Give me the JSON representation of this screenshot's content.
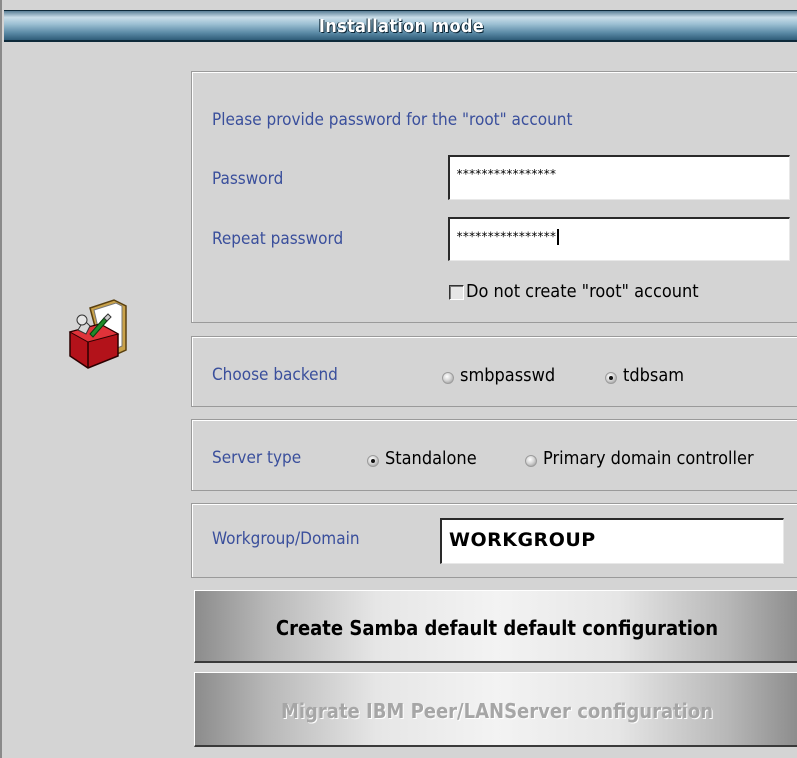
{
  "window": {
    "title": "Installation mode"
  },
  "icon": "samba-toolbox-icon",
  "password_panel": {
    "heading": "Please provide password for the \"root\" account",
    "password_label": "Password",
    "password_value": "****************",
    "repeat_label": "Repeat password",
    "repeat_value": "****************",
    "no_root_label": "Do not create \"root\" account",
    "no_root_checked": false
  },
  "backend_panel": {
    "label": "Choose backend",
    "options": [
      {
        "label": "smbpasswd",
        "checked": false
      },
      {
        "label": "tdbsam",
        "checked": true
      }
    ]
  },
  "server_panel": {
    "label": "Server type",
    "options": [
      {
        "label": "Standalone",
        "checked": true
      },
      {
        "label": "Primary domain controller",
        "checked": false
      }
    ]
  },
  "workgroup_panel": {
    "label": "Workgroup/Domain",
    "value": "WORKGROUP"
  },
  "buttons": {
    "create_label": "Create Samba default default configuration",
    "migrate_label": "Migrate IBM Peer/LANServer configuration",
    "migrate_enabled": false
  }
}
